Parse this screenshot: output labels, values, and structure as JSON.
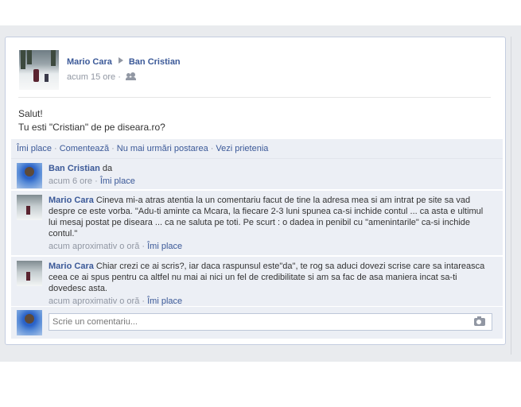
{
  "post": {
    "author": "Mario Cara",
    "target": "Ban Cristian",
    "time": "acum 15 ore",
    "time_sep": "·",
    "privacy_icon": "friends-icon",
    "message_line1": "Salut!",
    "message_line2": "Tu esti \"Cristian\" de pe diseara.ro?"
  },
  "actions": {
    "like": "Îmi place",
    "comment": "Comentează",
    "unfollow": "Nu mai urmări postarea",
    "friendship": "Vezi prietenia",
    "sep": "·"
  },
  "comments": [
    {
      "author": "Ban Cristian",
      "text": "da",
      "time": "acum 6 ore",
      "like": "Îmi place",
      "sep": "·"
    },
    {
      "author": "Mario Cara",
      "text": "Cineva mi-a atras atentia la un comentariu facut de tine la adresa mea si am intrat pe site sa vad despre ce este vorba. \"Adu-ti aminte ca Mcara, la fiecare 2-3 luni spunea ca-si inchide contul ... ca asta e ultimul lui mesaj postat pe diseara ... ca ne saluta pe toti. Pe scurt : o dadea in penibil cu \"amenintarile\" ca-si inchide contul.\"",
      "time": "acum aproximativ o oră",
      "like": "Îmi place",
      "sep": "·"
    },
    {
      "author": "Mario Cara",
      "text": "Chiar crezi ce ai scris?, iar daca raspunsul este\"da\", te rog sa aduci dovezi scrise care sa intareasca ceea ce ai spus pentru ca altfel nu mai ai nici un fel de credibilitate si am sa fac de asa maniera incat sa-ti dovedesc asta.",
      "time": "acum aproximativ o oră",
      "like": "Îmi place",
      "sep": "·"
    }
  ],
  "comment_input": {
    "placeholder": "Scrie un comentariu...",
    "camera_icon": "camera-icon"
  }
}
